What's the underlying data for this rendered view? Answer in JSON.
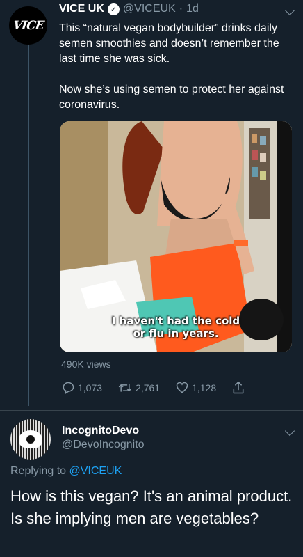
{
  "tweet": {
    "author_name": "VICE UK",
    "avatar_text": "VICE",
    "handle": "@VICEUK",
    "separator": "·",
    "time": "1d",
    "text_p1": "This “natural vegan bodybuilder” drinks daily semen smoothies and doesn’t remember the last time she was sick.",
    "text_p2": "Now she’s using semen to protect her against coronavirus.",
    "subtitle_line1": "I haven't had the cold",
    "subtitle_line2": "or flu in years.",
    "views": "490K views",
    "replies": "1,073",
    "retweets": "2,761",
    "likes": "1,128"
  },
  "reply": {
    "author_name": "IncognitoDevo",
    "handle": "@DevoIncognito",
    "replying_prefix": "Replying to",
    "replying_to": "@VICEUK",
    "text": "How is this vegan? It's an animal product. Is she implying men are vegetables?"
  },
  "icons": {
    "reply": "reply-icon",
    "retweet": "retweet-icon",
    "like": "heart-icon",
    "share": "share-icon",
    "more": "chevron-down-icon"
  },
  "colors": {
    "background": "#15202b",
    "muted": "#8899a6",
    "link": "#1da1f2",
    "divider": "#38444d"
  }
}
